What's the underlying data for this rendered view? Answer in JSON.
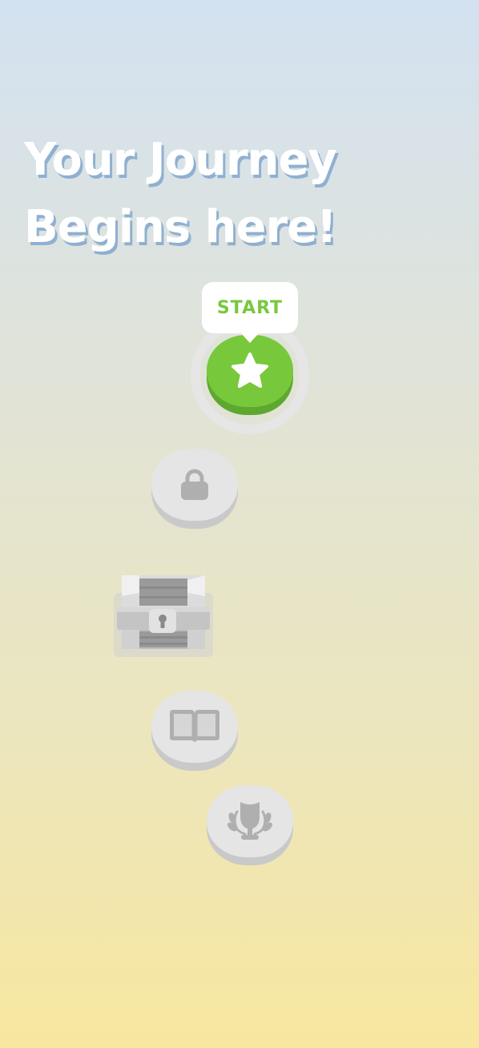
{
  "headline": {
    "line1": "Your Journey",
    "line2": "Begins here!"
  },
  "path": {
    "start": {
      "tooltip_label": "START",
      "icon": "star-icon",
      "progress": 0.08,
      "state": "active"
    },
    "nodes": [
      {
        "icon": "lock-icon",
        "state": "locked"
      },
      {
        "icon": "treasure-chest-icon",
        "state": "locked"
      },
      {
        "icon": "book-icon",
        "state": "locked"
      },
      {
        "icon": "trophy-icon",
        "state": "locked"
      }
    ]
  },
  "colors": {
    "active_green": "#78c83c",
    "active_green_shadow": "#5ea830",
    "locked_face": "#e5e5e5",
    "locked_shadow": "#c9c9c9",
    "locked_icon": "#afafaf",
    "progress_ring_track": "#e6e6e6",
    "progress_ring_fill": "#f5c431",
    "headline_shadow": "#8fb0d1"
  }
}
